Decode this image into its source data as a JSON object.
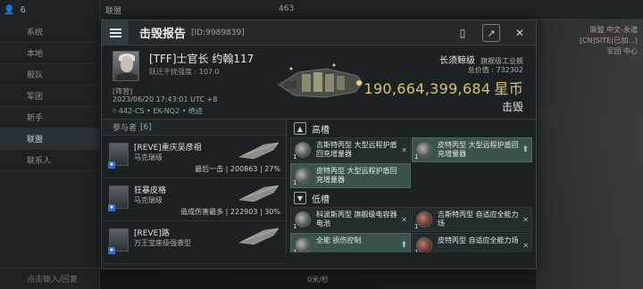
{
  "background": {
    "chat_count": "6",
    "chat_rows": [
      "系统",
      "本地",
      "舰队",
      "军团",
      "新手",
      "联盟",
      "联系人"
    ],
    "top_left_tab": "联盟",
    "top_counter": "463",
    "footer_placeholder": "点击输入/回复",
    "speed_readout": "0米/秒",
    "right_labels": [
      "联盟 中文-永道",
      "[CN]SITE(已加...)",
      "军团 中心"
    ]
  },
  "header": {
    "title": "击毁报告",
    "report_id": "[ID:9989839]"
  },
  "victim": {
    "name": "[TFF]士官长 约翰117",
    "stat": "跃迁干扰强度 : 107.0",
    "corp_tag": "[阵营]",
    "time": "2023/06/20 17:43:01 UTC +8",
    "location": "442-CS • EK-NQ2 • 绝迹"
  },
  "ship": {
    "name": "长须鲸级",
    "type": "旗舰级工业舰",
    "total_label": "总价值 : 732302",
    "isk_value": "190,664,399,684",
    "isk_unit": "星币",
    "result": "击毁"
  },
  "participants": {
    "header_label": "参与者",
    "count": "[6]",
    "rows": [
      {
        "name": "[REVE]重庆吴彦祖",
        "ship": "马克瑞级",
        "stat": "最后一击 | 200863 | 27%"
      },
      {
        "name": "狂暴皮格",
        "ship": "马克瑞级",
        "stat": "造成伤害最多 | 222903 | 30%"
      },
      {
        "name": "[REVE]路",
        "ship": "万王宝座级强袭型",
        "stat": ""
      }
    ]
  },
  "slots": {
    "high_title": "高槽",
    "low_title": "低槽",
    "high_modules": [
      {
        "qty": "1",
        "name": "吉斯特丙型 大型远程护盾回充增量器",
        "mark": "✕",
        "highlight": false,
        "tone": "grey"
      },
      {
        "qty": "1",
        "name": "皮特丙型 大型远程护盾回充增量器",
        "mark": "⬆",
        "highlight": true,
        "tone": "grey"
      },
      {
        "qty": "1",
        "name": "皮特丙型 大型远程护盾回充增量器",
        "mark": "",
        "highlight": true,
        "tone": "grey"
      }
    ],
    "low_modules": [
      {
        "qty": "1",
        "name": "科波斯丙型 旗舰级电容器电池",
        "mark": "✕",
        "highlight": false,
        "tone": "grey"
      },
      {
        "qty": "1",
        "name": "吉斯特丙型 自适应全能力场",
        "mark": "✕",
        "highlight": false,
        "tone": "red"
      },
      {
        "qty": "1",
        "name": "全能 损伤控制",
        "mark": "⬆",
        "highlight": true,
        "tone": "grey"
      },
      {
        "qty": "1",
        "name": "皮特丙型 自适应全能力场",
        "mark": "✕",
        "highlight": false,
        "tone": "red"
      }
    ]
  }
}
